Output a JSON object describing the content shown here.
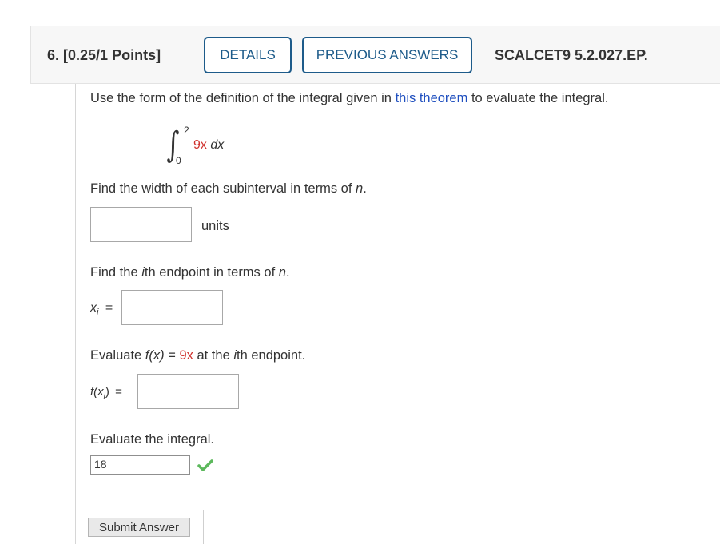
{
  "header": {
    "question_number": "6.",
    "points": "[0.25/1 Points]",
    "details_label": "DETAILS",
    "previous_answers_label": "PREVIOUS ANSWERS",
    "problem_code": "SCALCET9 5.2.027.EP."
  },
  "prompt": {
    "before_link": "Use the form of the definition of the integral given in ",
    "link_text": "this theorem",
    "after_link": " to evaluate the integral."
  },
  "integral": {
    "upper": "2",
    "lower": "0",
    "coef": "9x",
    "dx": " dx"
  },
  "q1": {
    "text_before": "Find the width of each subinterval in terms of ",
    "var": "n",
    "text_after": ".",
    "units": "units"
  },
  "q2": {
    "text_a": "Find the ",
    "i": "i",
    "text_b": "th endpoint in terms of ",
    "var": "n",
    "text_c": ".",
    "label_x": "x",
    "label_sub": "i",
    "equals": "="
  },
  "q3": {
    "text_a": "Evaluate ",
    "fx": "f(x)",
    "eq": " = ",
    "expr": "9x",
    "text_b": " at the ",
    "i": "i",
    "text_c": "th endpoint.",
    "label_f": "f(x",
    "label_sub": "i",
    "label_close": ")",
    "equals": "="
  },
  "q4": {
    "text": "Evaluate the integral.",
    "answer_value": "18"
  },
  "submit_label": "Submit Answer",
  "colors": {
    "accent": "#1d5b8a",
    "link": "#1f4fbf",
    "highlight": "#d0312d",
    "correct": "#5cb85c"
  }
}
